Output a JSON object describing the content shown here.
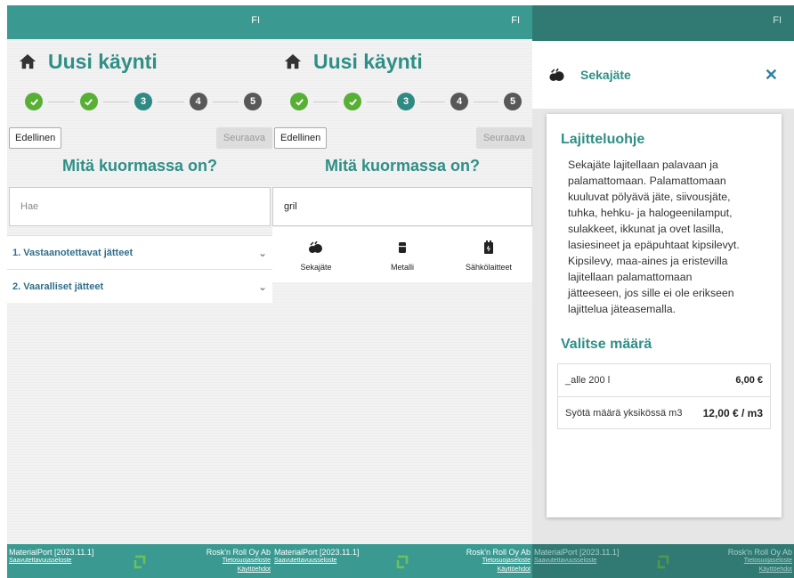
{
  "lang": "FI",
  "page_title": "Uusi käynti",
  "steps": [
    "3",
    "4",
    "5"
  ],
  "buttons": {
    "prev": "Edellinen",
    "next": "Seuraava"
  },
  "question": "Mitä kuormassa on?",
  "search": {
    "placeholder": "Hae",
    "value": "gril"
  },
  "categories": [
    "1. Vastaanotettavat jätteet",
    "2. Vaaralliset jätteet"
  ],
  "results": [
    "Sekajäte",
    "Metalli",
    "Sähkölaitteet"
  ],
  "footer": {
    "version": "MaterialPort [2023.11.1]",
    "access": "Saavutettavuusseloste",
    "company": "Rosk'n Roll Oy Ab",
    "privacy": "Tietosuojaseloste",
    "terms": "Käyttöehdot"
  },
  "modal": {
    "title": "Sekajäte",
    "close": "✕",
    "guide_title": "Lajitteluohje",
    "guide_lines": [
      "Sekajäte lajitellaan palavaan ja",
      "palamattomaan. Palamattomaan",
      "kuuluvat pölyävä jäte, siivousjäte,",
      "tuhka, hehku- ja halogeenilamput,",
      "sulakkeet, ikkunat ja ovet lasilla,",
      "lasiesineet ja epäpuhtaat kipsilevyt.",
      "Kipsilevy, maa-aines ja eristevilla",
      "lajitellaan palamattomaan",
      "jätteeseen, jos sille ei ole erikseen",
      "lajittelua jäteasemalla."
    ],
    "amount_title": "Valitse määrä",
    "options": [
      {
        "label": "_alle 200 l",
        "price": "6,00 €"
      },
      {
        "label": "Syötä määrä yksikössä m3",
        "price": "12,00 € / m3"
      }
    ]
  }
}
